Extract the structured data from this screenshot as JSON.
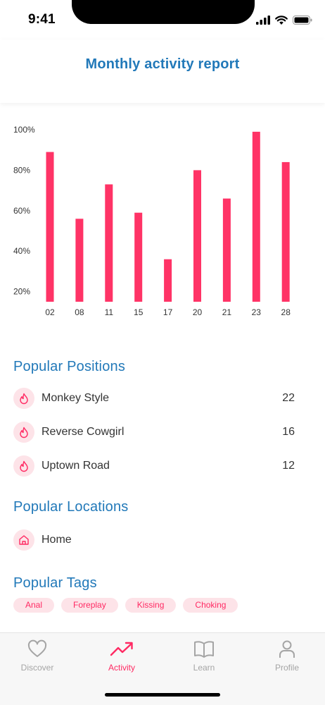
{
  "status": {
    "time": "9:41"
  },
  "header": {
    "title": "Monthly activity report"
  },
  "chart_data": {
    "type": "bar",
    "categories": [
      "02",
      "08",
      "11",
      "15",
      "17",
      "20",
      "21",
      "23",
      "28"
    ],
    "values": [
      89,
      56,
      73,
      59,
      36,
      80,
      66,
      99,
      84
    ],
    "y_ticks": [
      "100%",
      "80%",
      "60%",
      "40%",
      "20%"
    ],
    "ylim": [
      15,
      100
    ],
    "grid": false,
    "bar_color": "#ff3366",
    "title": "",
    "xlabel": "",
    "ylabel": ""
  },
  "positions": {
    "title": "Popular Positions",
    "items": [
      {
        "label": "Monkey Style",
        "count": "22",
        "icon": "flame-icon"
      },
      {
        "label": "Reverse Cowgirl",
        "count": "16",
        "icon": "flame-icon"
      },
      {
        "label": "Uptown Road",
        "count": "12",
        "icon": "flame-icon"
      }
    ]
  },
  "locations": {
    "title": "Popular Locations",
    "items": [
      {
        "label": "Home",
        "icon": "home-icon"
      }
    ]
  },
  "tags": {
    "title": "Popular Tags",
    "items": [
      "Anal",
      "Foreplay",
      "Kissing",
      "Choking"
    ]
  },
  "tabbar": {
    "tabs": [
      {
        "label": "Discover",
        "icon": "heart-icon"
      },
      {
        "label": "Activity",
        "icon": "trending-up-icon",
        "active": true
      },
      {
        "label": "Learn",
        "icon": "book-icon"
      },
      {
        "label": "Profile",
        "icon": "person-icon"
      }
    ]
  },
  "colors": {
    "accent": "#ff2a63",
    "title_blue": "#2279b9",
    "icon_bg": "#fde3e8"
  }
}
